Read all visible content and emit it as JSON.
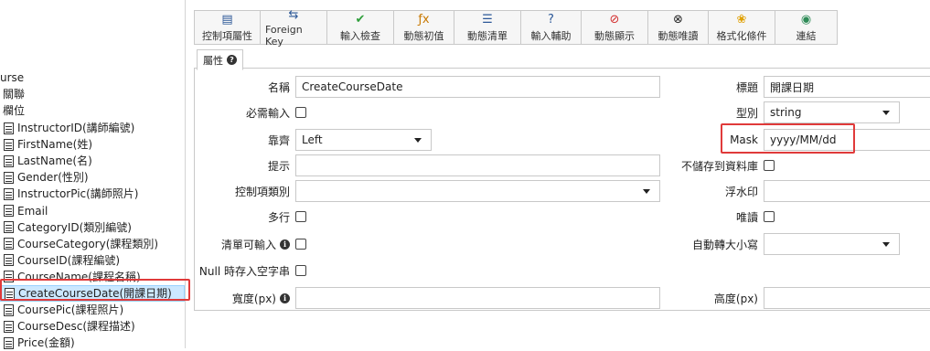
{
  "tree": {
    "partial_1": "urse",
    "partial_2": "關聯",
    "partial_3": "欄位",
    "items": [
      "InstructorID(講師編號)",
      "FirstName(姓)",
      "LastName(名)",
      "Gender(性別)",
      "InstructorPic(講師照片)",
      "Email",
      "CategoryID(類別編號)",
      "CourseCategory(課程類別)",
      "CourseID(課程編號)",
      "CourseName(課程名稱)",
      "CreateCourseDate(開課日期)",
      "CoursePic(課程照片)",
      "CourseDesc(課程描述)",
      "Price(金額)"
    ],
    "selected_index": 10
  },
  "toolbar": {
    "buttons": [
      {
        "label": "控制項屬性",
        "icon": "▤",
        "color": "#2b5797"
      },
      {
        "label": "Foreign Key",
        "icon": "⇆",
        "color": "#2b5797"
      },
      {
        "label": "輸入檢查",
        "icon": "✔",
        "color": "#2e9e3a"
      },
      {
        "label": "動態初值",
        "icon": "ƒx",
        "color": "#c87800"
      },
      {
        "label": "動態清單",
        "icon": "☰",
        "color": "#2b5797"
      },
      {
        "label": "輸入輔助",
        "icon": "?",
        "color": "#2b5797"
      },
      {
        "label": "動態顯示",
        "icon": "⊘",
        "color": "#d32f2f"
      },
      {
        "label": "動態唯讀",
        "icon": "⊗",
        "color": "#222222"
      },
      {
        "label": "格式化條件",
        "icon": "❀",
        "color": "#e0a000"
      },
      {
        "label": "連結",
        "icon": "◉",
        "color": "#2e8b57"
      }
    ]
  },
  "tab": {
    "label": "屬性",
    "help": "?"
  },
  "form": {
    "name_label": "名稱",
    "name_value": "CreateCourseDate",
    "title_label": "標題",
    "title_value": "開課日期",
    "required_label": "必需輸入",
    "type_label": "型別",
    "type_value": "string",
    "align_label": "靠齊",
    "align_value": "Left",
    "mask_label": "Mask",
    "mask_value": "yyyy/MM/dd",
    "hint_label": "提示",
    "nosave_label": "不儲存到資料庫",
    "ctrltype_label": "控制項類別",
    "watermark_label": "浮水印",
    "multiline_label": "多行",
    "readonly_label": "唯讀",
    "listinput_label": "清單可輸入",
    "autocase_label": "自動轉大小寫",
    "nullempty_label": "Null 時存入空字串",
    "width_label": "寬度(px)",
    "height_label": "高度(px)",
    "info": "i"
  }
}
